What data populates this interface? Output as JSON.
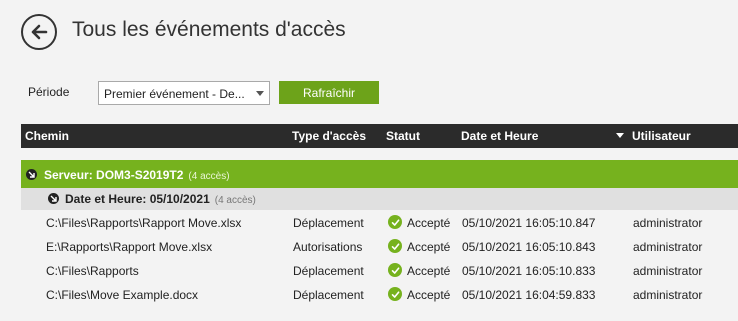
{
  "page": {
    "title": "Tous les événements d'accès",
    "back_icon": "arrow-left-icon"
  },
  "filter": {
    "period_label": "Période",
    "period_value": "Premier événement - De...",
    "refresh_label": "Rafraîchir"
  },
  "grid": {
    "columns": {
      "path": "Chemin",
      "access_type": "Type d'accès",
      "status": "Statut",
      "datetime": "Date et Heure",
      "user": "Utilisateur"
    },
    "sort_column": "datetime",
    "sort_direction": "descending",
    "server_group": {
      "label": "Serveur: DOM3-S2019T2",
      "count": "(4 accès)"
    },
    "date_group": {
      "label": "Date et Heure: 05/10/2021",
      "count": "(4 accès)"
    },
    "rows": [
      {
        "path": "C:\\Files\\Rapports\\Rapport Move.xlsx",
        "access_type": "Déplacement",
        "status": "Accepté",
        "datetime": "05/10/2021 16:05:10.847",
        "user": "administrator"
      },
      {
        "path": "E:\\Rapports\\Rapport Move.xlsx",
        "access_type": "Autorisations",
        "status": "Accepté",
        "datetime": "05/10/2021 16:05:10.843",
        "user": "administrator"
      },
      {
        "path": "C:\\Files\\Rapports",
        "access_type": "Déplacement",
        "status": "Accepté",
        "datetime": "05/10/2021 16:05:10.833",
        "user": "administrator"
      },
      {
        "path": "C:\\Files\\Move Example.docx",
        "access_type": "Déplacement",
        "status": "Accepté",
        "datetime": "05/10/2021 16:04:59.833",
        "user": "administrator"
      }
    ]
  },
  "colors": {
    "accent": "#76b21e",
    "button": "#6da31a",
    "header_bg": "#2b2b2b",
    "subgroup_bg": "#e0e0e0"
  }
}
